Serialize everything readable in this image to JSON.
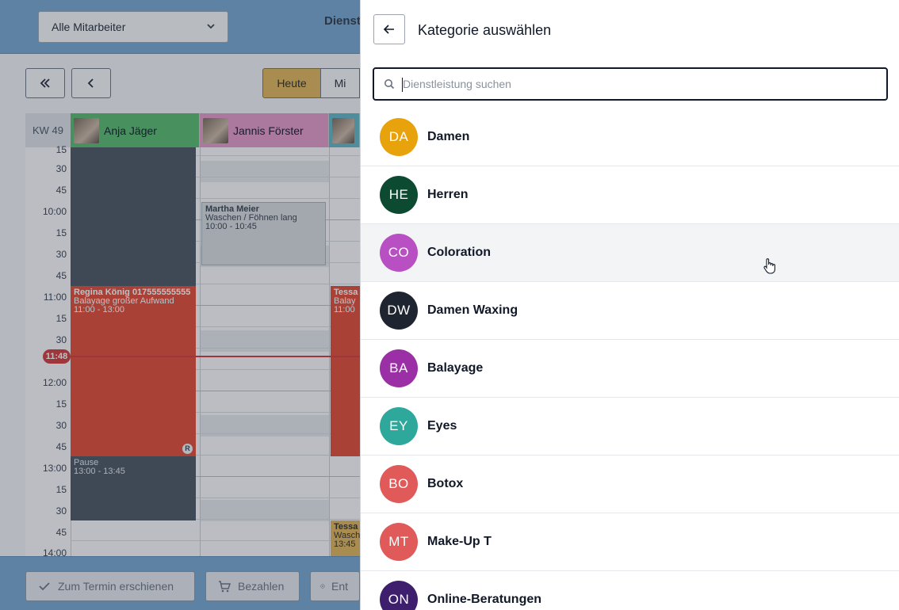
{
  "background": {
    "employee_select": "Alle Mitarbeiter",
    "top_title": "Dienst",
    "nav": {
      "today": "Heute",
      "mi": "Mi"
    },
    "week_label": "KW 49",
    "employees": [
      {
        "name": "Anja Jäger"
      },
      {
        "name": "Jannis Förster"
      }
    ],
    "time_labels": [
      "15",
      "30",
      "45",
      "10:00",
      "15",
      "30",
      "45",
      "11:00",
      "15",
      "30",
      "",
      "12:00",
      "15",
      "30",
      "45",
      "13:00",
      "15",
      "30",
      "45",
      "14:00"
    ],
    "now_time": "11:48",
    "events": {
      "regina": {
        "name": "Regina König 017555555555",
        "service": "Balayage großer Aufwand",
        "time": "11:00 - 13:00",
        "badge": "R"
      },
      "martha": {
        "name": "Martha Meier",
        "service": "Waschen / Föhnen lang",
        "time": "10:00 - 10:45"
      },
      "pause": {
        "name": "Pause",
        "time": "13:00 - 13:45"
      },
      "tessa": {
        "name": "Tessa",
        "service": "Balay",
        "time": "11:00"
      },
      "tessa2": {
        "name": "Tessa",
        "service": "Wasch",
        "time": "13:45"
      }
    },
    "actions": {
      "appeared": "Zum Termin erschienen",
      "pay": "Bezahlen",
      "cancel": "Ent"
    }
  },
  "panel": {
    "title": "Kategorie auswählen",
    "search_placeholder": "Dienstleistung suchen",
    "categories": [
      {
        "initials": "DA",
        "label": "Damen",
        "color": "#e8a20c"
      },
      {
        "initials": "HE",
        "label": "Herren",
        "color": "#0d4a32"
      },
      {
        "initials": "CO",
        "label": "Coloration",
        "color": "#b84fc2"
      },
      {
        "initials": "DW",
        "label": "Damen Waxing",
        "color": "#1f2530"
      },
      {
        "initials": "BA",
        "label": "Balayage",
        "color": "#9b2fa6"
      },
      {
        "initials": "EY",
        "label": "Eyes",
        "color": "#2fa89c"
      },
      {
        "initials": "BO",
        "label": "Botox",
        "color": "#e05a5a"
      },
      {
        "initials": "MT",
        "label": "Make-Up T",
        "color": "#e05a5a"
      },
      {
        "initials": "ON",
        "label": "Online-Beratungen",
        "color": "#3d1f6e"
      }
    ]
  }
}
